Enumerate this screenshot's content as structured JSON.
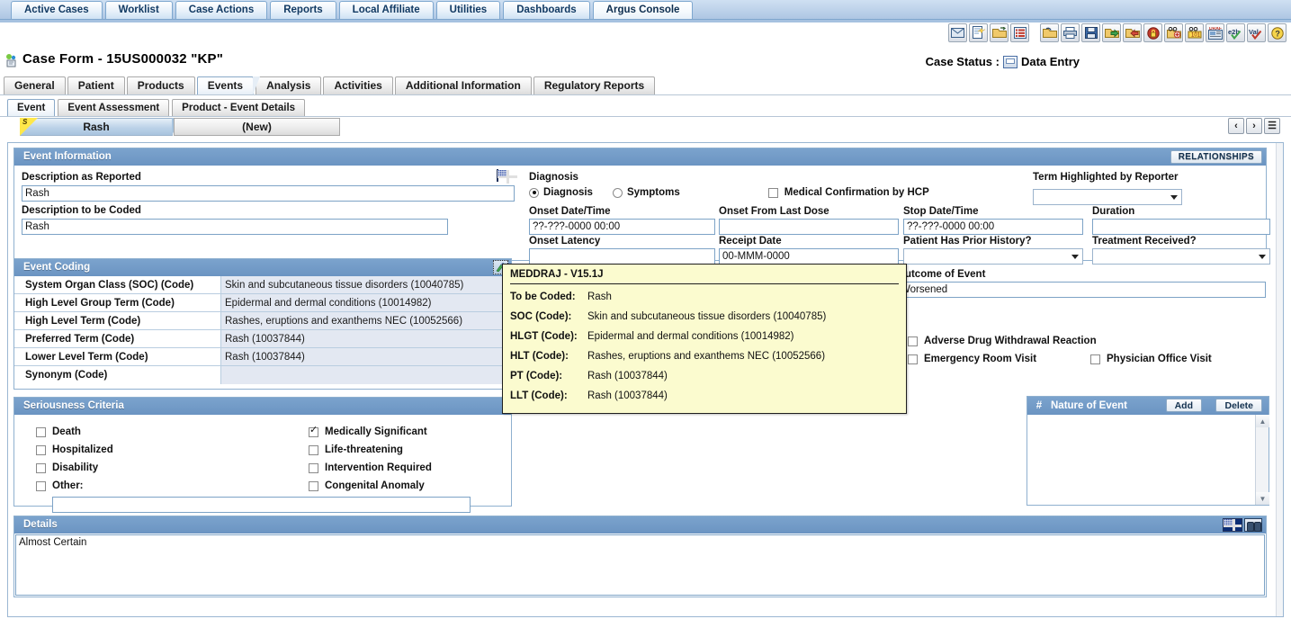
{
  "topnav": {
    "tabs": [
      {
        "label": "Active Cases",
        "active": false
      },
      {
        "label": "Worklist",
        "active": false
      },
      {
        "label": "Case Actions",
        "active": false
      },
      {
        "label": "Reports",
        "active": false
      },
      {
        "label": "Local Affiliate",
        "active": false
      },
      {
        "label": "Utilities",
        "active": false
      },
      {
        "label": "Dashboards",
        "active": false
      },
      {
        "label": "Argus Console",
        "active": true
      }
    ]
  },
  "toolbar": {
    "icons": [
      "email-icon",
      "new-case-icon",
      "open-case-icon",
      "worklist-icon",
      "open-folder-icon",
      "print-icon",
      "save-icon",
      "route-forward-icon",
      "route-back-icon",
      "lock-icon",
      "medical-review-icon",
      "coding-icon",
      "draft-report-icon",
      "e2b-check-icon",
      "validate-icon",
      "help-icon"
    ]
  },
  "header": {
    "title": "Case Form - 15US000032 \"KP\"",
    "status_label": "Case Status :",
    "status_value": "Data Entry"
  },
  "main_tabs": [
    {
      "label": "General",
      "active": false
    },
    {
      "label": "Patient",
      "active": false
    },
    {
      "label": "Products",
      "active": false
    },
    {
      "label": "Events",
      "active": true
    },
    {
      "label": "Analysis",
      "active": false
    },
    {
      "label": "Activities",
      "active": false
    },
    {
      "label": "Additional Information",
      "active": false
    },
    {
      "label": "Regulatory Reports",
      "active": false
    }
  ],
  "sub_tabs": [
    {
      "label": "Event",
      "active": true
    },
    {
      "label": "Event Assessment",
      "active": false
    },
    {
      "label": "Product - Event Details",
      "active": false
    }
  ],
  "event_bar": {
    "selected_event": "Rash",
    "new_event": "(New)",
    "serious_marker": "S",
    "nav_prev": "‹",
    "nav_next": "›",
    "nav_list": "☰"
  },
  "event_information": {
    "panel_title": "Event Information",
    "relationships_button": "RELATIONSHIPS",
    "description_as_reported_label": "Description as Reported",
    "description_as_reported_value": "Rash",
    "description_to_be_coded_label": "Description to be Coded",
    "description_to_be_coded_value": "Rash",
    "diagnosis_label": "Diagnosis",
    "radio_diagnosis": "Diagnosis",
    "radio_symptoms": "Symptoms",
    "radio_selected": "Diagnosis",
    "medical_confirmation_label": "Medical Confirmation by HCP",
    "medical_confirmation_checked": false,
    "term_highlighted_label": "Term Highlighted by Reporter",
    "term_highlighted_value": "",
    "onset_datetime_label": "Onset Date/Time",
    "onset_datetime_value": "??-???-0000 00:00",
    "onset_from_last_dose_label": "Onset From Last Dose",
    "onset_from_last_dose_value": "",
    "stop_datetime_label": "Stop Date/Time",
    "stop_datetime_value": "??-???-0000 00:00",
    "duration_label": "Duration",
    "duration_value": "",
    "onset_latency_label": "Onset Latency",
    "onset_latency_value": "",
    "receipt_date_label": "Receipt Date",
    "receipt_date_value": "00-MMM-0000",
    "patient_prior_history_label": "Patient Has Prior History?",
    "patient_prior_history_value": "",
    "treatment_received_label": "Treatment Received?",
    "treatment_received_value": "",
    "outcome_of_event_label": "Outcome of Event",
    "outcome_of_event_value": "Worsened",
    "adverse_drug_withdrawal_label": "Adverse Drug Withdrawal Reaction",
    "adverse_drug_withdrawal_checked": false,
    "emergency_room_label": "Emergency Room Visit",
    "emergency_room_checked": false,
    "physician_office_label": "Physician Office Visit",
    "physician_office_checked": false,
    "language_flag": "uk-flag-icon"
  },
  "event_coding": {
    "panel_title": "Event Coding",
    "coding_icon": "meddra-browser-icon",
    "rows": [
      {
        "label": "System Organ Class (SOC) (Code)",
        "value": "Skin and subcutaneous tissue disorders (10040785)"
      },
      {
        "label": "High Level Group Term (Code)",
        "value": "Epidermal and dermal conditions (10014982)"
      },
      {
        "label": "High Level Term (Code)",
        "value": "Rashes, eruptions and exanthems NEC (10052566)"
      },
      {
        "label": "Preferred Term (Code)",
        "value": "Rash (10037844)"
      },
      {
        "label": "Lower Level Term (Code)",
        "value": "Rash (10037844)"
      },
      {
        "label": "Synonym (Code)",
        "value": ""
      }
    ]
  },
  "meddra_tooltip": {
    "title": "MEDDRAJ - V15.1J",
    "rows": [
      {
        "key": "To be Coded:",
        "value": "Rash"
      },
      {
        "key": "SOC (Code):",
        "value": "Skin and subcutaneous tissue disorders (10040785)"
      },
      {
        "key": "HLGT (Code):",
        "value": "Epidermal and dermal conditions (10014982)"
      },
      {
        "key": "HLT (Code):",
        "value": "Rashes, eruptions and exanthems NEC (10052566)"
      },
      {
        "key": "PT (Code):",
        "value": "Rash (10037844)"
      },
      {
        "key": "LLT (Code):",
        "value": "Rash (10037844)"
      }
    ]
  },
  "seriousness": {
    "panel_title": "Seriousness Criteria",
    "left_items": [
      {
        "label": "Death",
        "checked": false
      },
      {
        "label": "Hospitalized",
        "checked": false
      },
      {
        "label": "Disability",
        "checked": false
      },
      {
        "label": "Other:",
        "checked": false
      }
    ],
    "right_items": [
      {
        "label": "Medically Significant",
        "checked": true
      },
      {
        "label": "Life-threatening",
        "checked": false
      },
      {
        "label": "Intervention Required",
        "checked": false
      },
      {
        "label": "Congenital Anomaly",
        "checked": false
      }
    ],
    "other_value": ""
  },
  "nature_of_event": {
    "hash_label": "#",
    "title": "Nature of Event",
    "add_button": "Add",
    "delete_button": "Delete",
    "rows": []
  },
  "details": {
    "panel_title": "Details",
    "value": "Almost Certain",
    "flag_icon": "uk-flag-icon",
    "lookup_icon": "binoculars-icon"
  },
  "colors": {
    "panel_header": "#6b94c2",
    "panel_border": "#8fb0cf",
    "tooltip_bg": "#fbfbcf",
    "readonly_field": "#e3e8f2",
    "topnav_bg": "#aec6e3",
    "marker_yellow": "#ffe84a"
  }
}
